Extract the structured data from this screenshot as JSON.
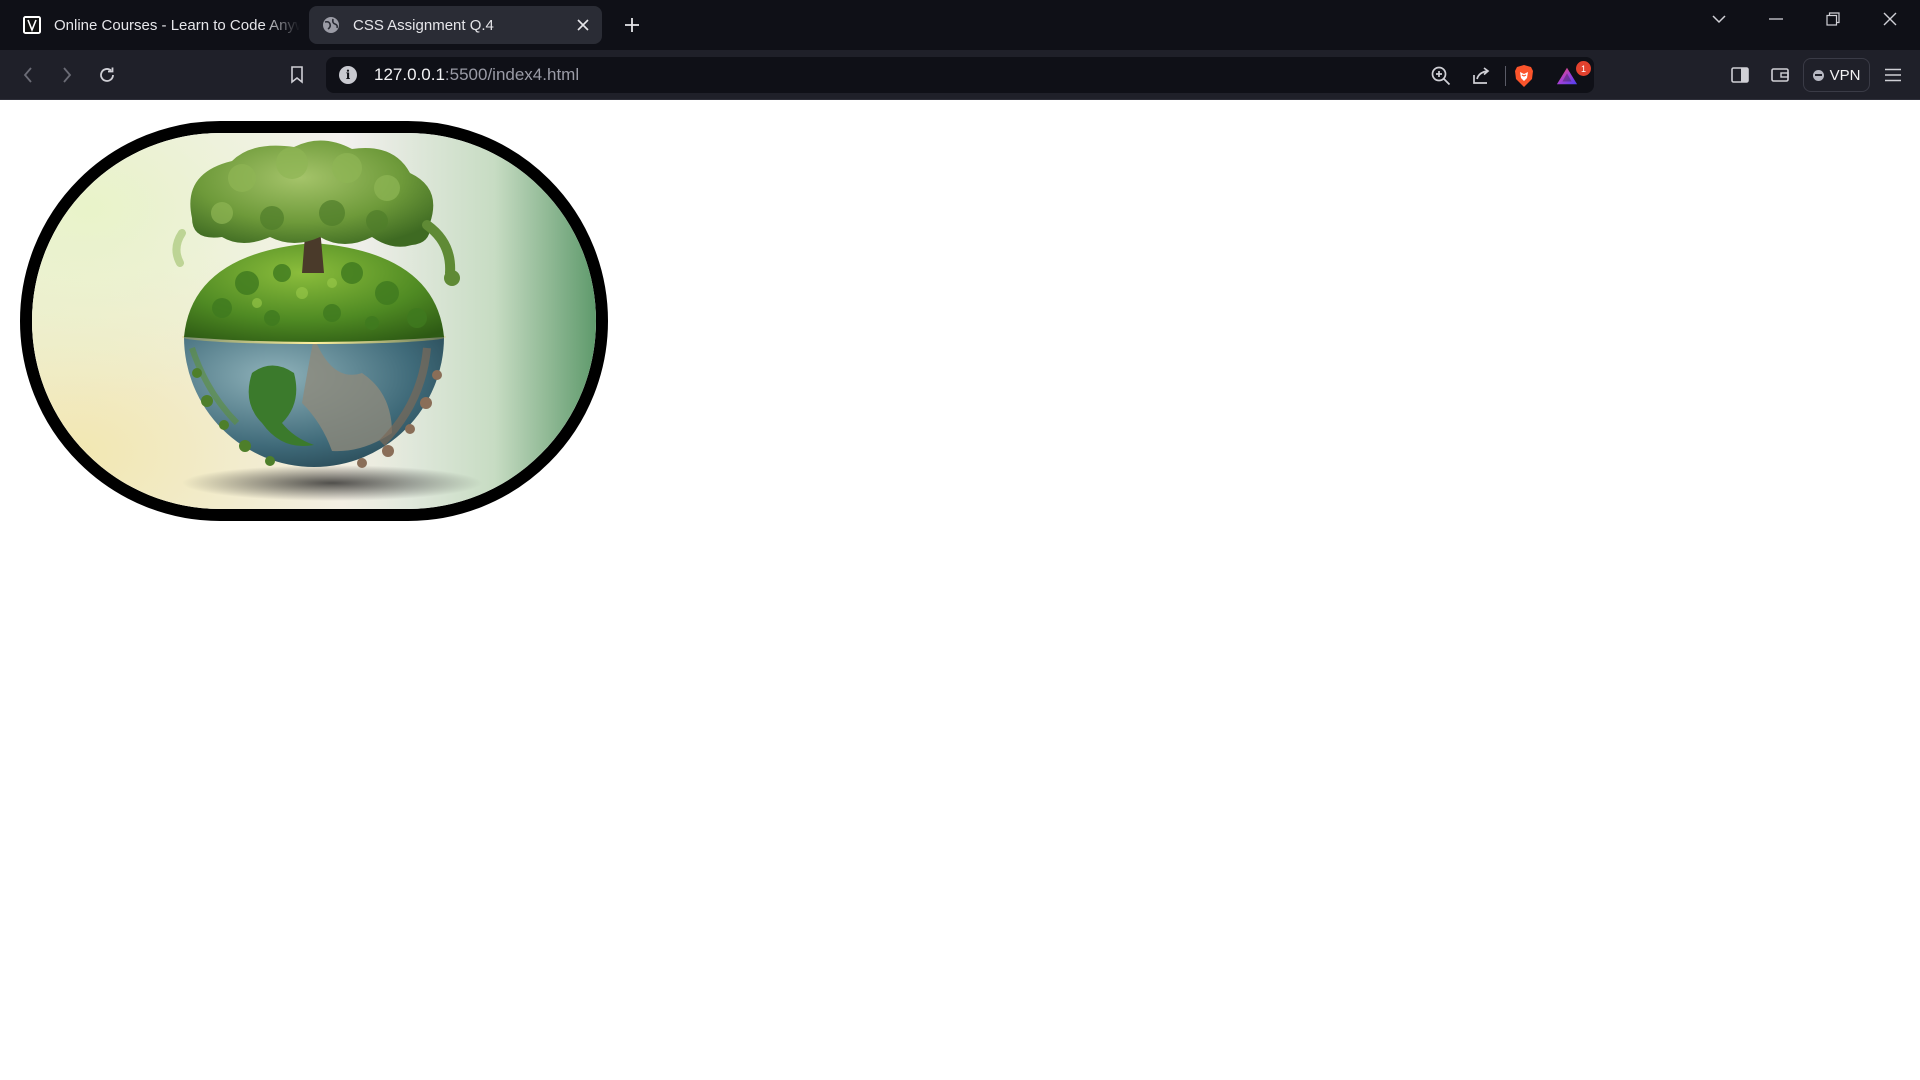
{
  "browser": {
    "tabs": [
      {
        "title": "Online Courses - Learn to Code Anyw",
        "icon": "site-logo-icon",
        "active": false
      },
      {
        "title": "CSS Assignment Q.4",
        "icon": "globe-icon",
        "active": true
      }
    ],
    "address": {
      "host": "127.0.0.1",
      "rest": ":5500/index4.html"
    },
    "vpn_label": "VPN",
    "notification_count": "1"
  },
  "page": {
    "image_subject": "earth-globe-with-tree-image"
  },
  "colors": {
    "titlebar": "#0f1017",
    "toolbar": "#1f2029",
    "active_tab": "#2a2c35",
    "image_border": "#000000"
  }
}
